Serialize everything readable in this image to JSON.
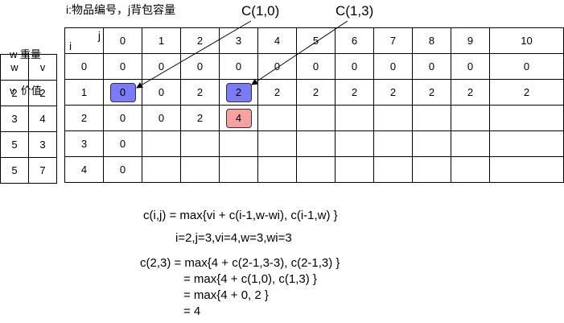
{
  "legend": {
    "weight_line": "w 重量",
    "value_line": "v  价值"
  },
  "top_note": "i:物品编号，j背包容量",
  "callouts": {
    "left": "C(1,0)",
    "right": "C(1,3)"
  },
  "items_table": {
    "headers": [
      "w",
      "v"
    ],
    "rows": [
      [
        "2",
        "2"
      ],
      [
        "3",
        "4"
      ],
      [
        "5",
        "3"
      ],
      [
        "5",
        "7"
      ]
    ]
  },
  "dp_table": {
    "j_label": "j",
    "i_label": "i",
    "col_headers": [
      "0",
      "1",
      "2",
      "3",
      "4",
      "5",
      "6",
      "7",
      "8",
      "9",
      "10"
    ],
    "rows": [
      {
        "i": "0",
        "cells": [
          "0",
          "0",
          "0",
          "0",
          "0",
          "0",
          "0",
          "0",
          "0",
          "0",
          "0"
        ]
      },
      {
        "i": "1",
        "cells": [
          "0",
          "0",
          "2",
          "2",
          "2",
          "2",
          "2",
          "2",
          "2",
          "2",
          "2"
        ]
      },
      {
        "i": "2",
        "cells": [
          "0",
          "0",
          "2",
          "4",
          "",
          "",
          "",
          "",
          "",
          "",
          ""
        ]
      },
      {
        "i": "3",
        "cells": [
          "0",
          "",
          "",
          "",
          "",
          "",
          "",
          "",
          "",
          "",
          ""
        ]
      },
      {
        "i": "4",
        "cells": [
          "0",
          "",
          "",
          "",
          "",
          "",
          "",
          "",
          "",
          "",
          ""
        ]
      }
    ]
  },
  "colors": {
    "blue_highlight": "#7b7bfa",
    "red_highlight": "#f9a0a0"
  },
  "formula": {
    "general": "c(i,j) = max{vi + c(i-1,w-wi), c(i-1,w) }",
    "params": "i=2,j=3,vi=4,w=3,wi=3",
    "line1": "c(2,3) = max{4 + c(2-1,3-3), c(2-1,3) }",
    "line2": "= max{4 + c(1,0), c(1,3) }",
    "line3": "= max{4 + 0, 2 }",
    "line4": "= 4"
  }
}
